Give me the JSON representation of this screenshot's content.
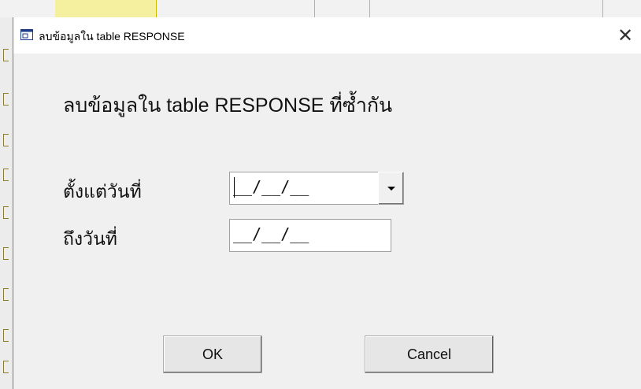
{
  "dialog": {
    "title": "ลบข้อมูลใน table RESPONSE",
    "close_glyph": "✕",
    "heading": "ลบข้อมูลใน table RESPONSE ที่ซ้ำกัน",
    "from_label": "ตั้งแต่วันที่",
    "from_value": "__/__/__",
    "to_label": "ถึงวันที่",
    "to_value": "__/__/__",
    "ok_label": "OK",
    "cancel_label": "Cancel"
  },
  "icons": {
    "title": "window-icon",
    "dropdown": "chevron-down-icon"
  }
}
